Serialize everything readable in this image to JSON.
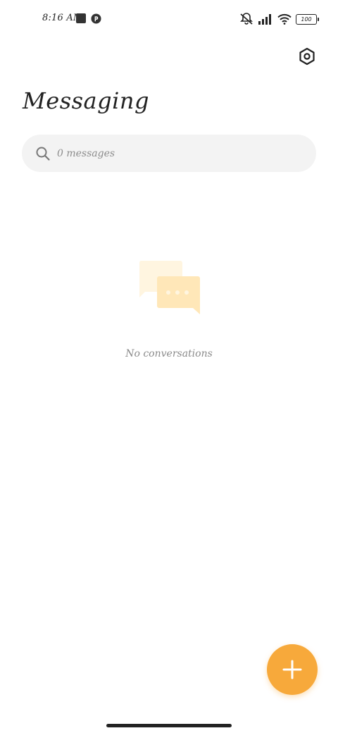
{
  "status_bar": {
    "time": "8:16 AM",
    "battery_level": "100",
    "icons": [
      "notification-square-icon",
      "app-notification-icon",
      "silent-mode-icon",
      "signal-icon",
      "wifi-icon",
      "battery-icon"
    ]
  },
  "header": {
    "title": "Messaging",
    "settings_icon": "settings-hexagon-icon"
  },
  "search": {
    "placeholder": "0 messages",
    "value": "",
    "icon": "search-icon"
  },
  "empty_state": {
    "icon": "chat-bubbles-icon",
    "message": "No conversations"
  },
  "fab": {
    "icon": "plus-icon"
  },
  "colors": {
    "accent": "#F7A93B",
    "illustration_light": "#FFF5E0",
    "illustration_mid": "#FFE7B8",
    "search_bg": "#F3F3F3",
    "text_primary": "#222222",
    "text_secondary": "#8A8A8A"
  }
}
